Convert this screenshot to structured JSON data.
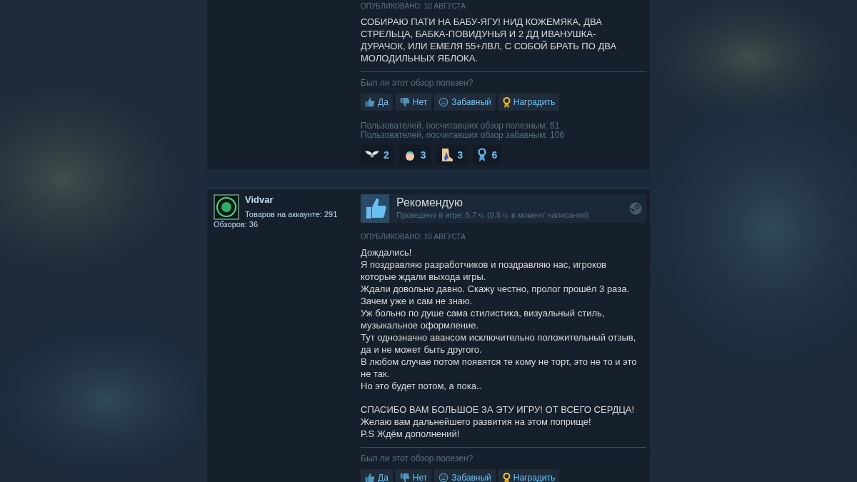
{
  "reviews": [
    {
      "posted": "ОПУБЛИКОВАНО: 10 АВГУСТА",
      "paragraphs": [
        [
          "СОБИРАЮ ПАТИ НА БАБУ-ЯГУ! НИД КОЖЕМЯКА, ДВА СТРЕЛЬЦА, БАБКА-ПОВИДУНЬЯ И 2 ДД ИВАНУШКА-ДУРАЧОК, ИЛИ ЕМЕЛЯ 55+ЛВЛ, С СОБОЙ БРАТЬ ПО ДВА МОЛОДИЛЬНЫХ ЯБЛОКА."
        ]
      ],
      "helpful_prompt": "Был ли этот обзор полезен?",
      "votes": [
        {
          "kind": "up",
          "label": "Да"
        },
        {
          "kind": "down",
          "label": "Нет"
        },
        {
          "kind": "funny",
          "label": "Забавный"
        },
        {
          "kind": "award",
          "label": "Наградить"
        }
      ],
      "stats": [
        "Пользователей, посчитавших обзор полезным: 51",
        "Пользователей, посчитавших обзор забавным: 106"
      ],
      "awards": [
        {
          "kind": "wings",
          "count": "2"
        },
        {
          "kind": "baby",
          "count": "3"
        },
        {
          "kind": "boot",
          "count": "3"
        },
        {
          "kind": "ribbon",
          "count": "6"
        }
      ]
    },
    {
      "author": {
        "name": "Vidvar",
        "products": "Товаров на аккаунте: 291",
        "reviews": "Обзоров: 36"
      },
      "verdict": "Рекомендую",
      "playtime": "Проведено в игре: 5.7 ч. (0.5 ч. в момент написания)",
      "posted": "ОПУБЛИКОВАНО: 10 АВГУСТА",
      "paragraphs": [
        [
          "Дождались!",
          "Я поздравляю разработчиков и поздравляю нас, игроков которые ждали выхода игры.",
          "Ждали довольно давно. Скажу честно, пролог прошёл 3 раза. Зачем уже и сам не знаю.",
          "Уж больно по душе сама стилистика, визуальный стиль, музыкальное оформление.",
          "Тут однозначно авансом исключительно положительный отзыв, да и не может быть другого.",
          "В любом случае потом появятся те кому не торт, это не то и это не так.",
          "Но это будет потом, а пока.."
        ],
        [
          "СПАСИБО ВАМ БОЛЬШОЕ ЗА ЭТУ ИГРУ! ОТ ВСЕГО СЕРДЦА!",
          "Желаю вам дальнейшего развития на этом поприще!",
          "P.S Ждём дополнений!"
        ]
      ],
      "helpful_prompt": "Был ли этот обзор полезен?",
      "votes": [
        {
          "kind": "up",
          "label": "Да"
        },
        {
          "kind": "down",
          "label": "Нет"
        },
        {
          "kind": "funny",
          "label": "Забавный"
        },
        {
          "kind": "award",
          "label": "Наградить"
        }
      ]
    }
  ]
}
